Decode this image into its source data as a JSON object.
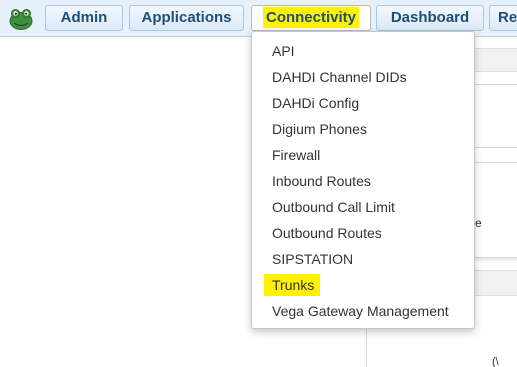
{
  "nav": {
    "items": [
      {
        "label": "Admin"
      },
      {
        "label": "Applications"
      },
      {
        "label": "Connectivity"
      },
      {
        "label": "Dashboard"
      },
      {
        "label": "Re"
      }
    ]
  },
  "dropdown": {
    "items": [
      {
        "label": "API"
      },
      {
        "label": "DAHDI Channel DIDs"
      },
      {
        "label": "DAHDi Config"
      },
      {
        "label": "Digium Phones"
      },
      {
        "label": "Firewall"
      },
      {
        "label": "Inbound Routes"
      },
      {
        "label": "Outbound Call Limit"
      },
      {
        "label": "Outbound Routes"
      },
      {
        "label": "SIPSTATION"
      },
      {
        "label": "Trunks"
      },
      {
        "label": "Vega Gateway Management"
      }
    ]
  },
  "background": {
    "fragment_e": "e",
    "fragment_bottom": "(\\"
  },
  "colors": {
    "highlight": "#fff200",
    "nav_text": "#1f4e79",
    "topbar_bg": "#e6f1fb"
  },
  "icons": {
    "logo": "frog-logo-icon"
  }
}
